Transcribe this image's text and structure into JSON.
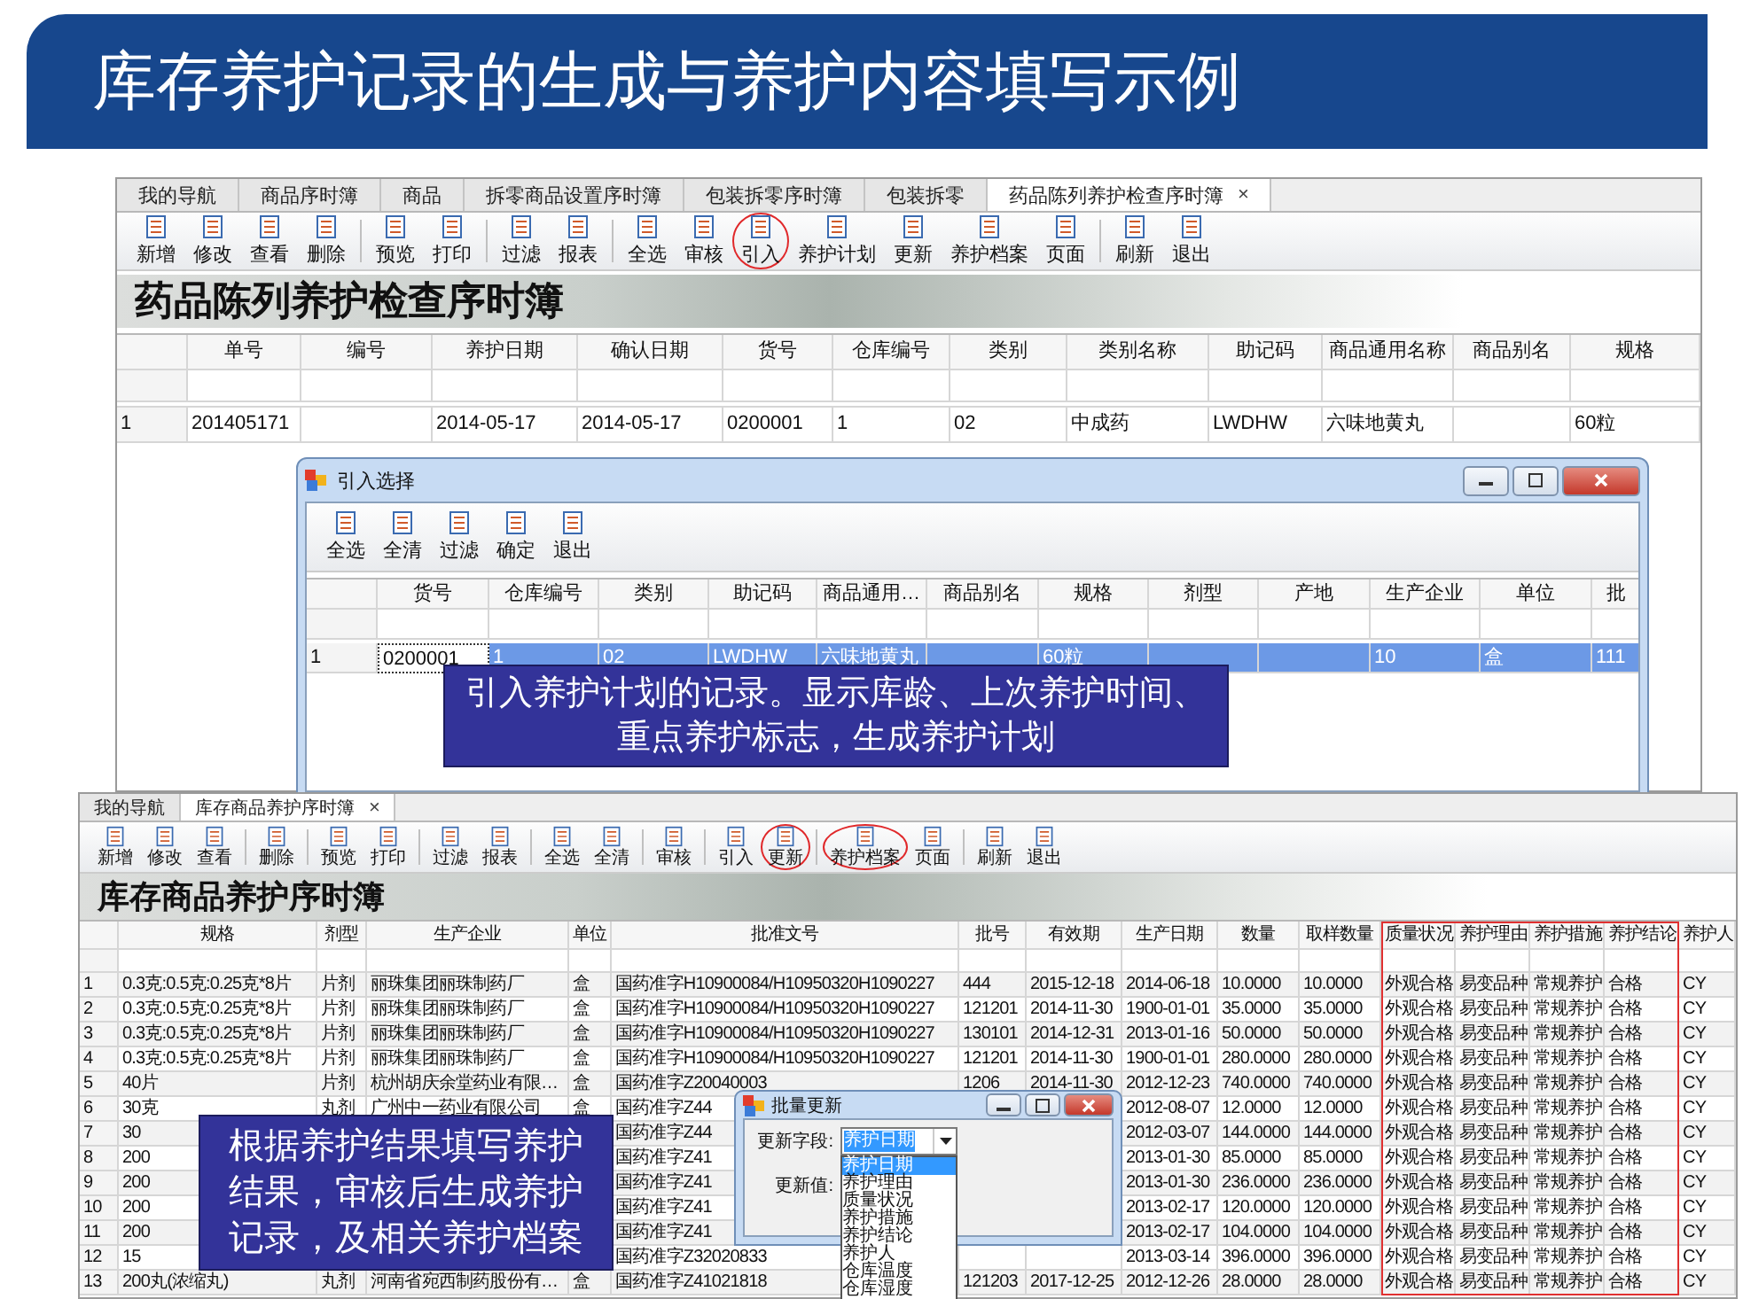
{
  "slide_title": "库存养护记录的生成与养护内容填写示例",
  "main_window": {
    "tabs": [
      {
        "label": "我的导航",
        "selected": false
      },
      {
        "label": "商品序时簿",
        "selected": false
      },
      {
        "label": "商品",
        "selected": false
      },
      {
        "label": "拆零商品设置序时簿",
        "selected": false
      },
      {
        "label": "包装拆零序时簿",
        "selected": false
      },
      {
        "label": "包装拆零",
        "selected": false
      },
      {
        "label": "药品陈列养护检查序时簿",
        "selected": true,
        "close": "×"
      }
    ],
    "toolbar": [
      {
        "label": "新增",
        "separator_before": false,
        "circled": false
      },
      {
        "label": "修改",
        "separator_before": false,
        "circled": false
      },
      {
        "label": "查看",
        "separator_before": false,
        "circled": false
      },
      {
        "label": "删除",
        "separator_before": false,
        "circled": false
      },
      {
        "label": "预览",
        "separator_before": true,
        "circled": false
      },
      {
        "label": "打印",
        "separator_before": false,
        "circled": false
      },
      {
        "label": "过滤",
        "separator_before": true,
        "circled": false
      },
      {
        "label": "报表",
        "separator_before": false,
        "circled": false
      },
      {
        "label": "全选",
        "separator_before": true,
        "circled": false
      },
      {
        "label": "审核",
        "separator_before": false,
        "circled": false
      },
      {
        "label": "引入",
        "separator_before": false,
        "circled": true
      },
      {
        "label": "养护计划",
        "separator_before": false,
        "circled": false
      },
      {
        "label": "更新",
        "separator_before": false,
        "circled": false
      },
      {
        "label": "养护档案",
        "separator_before": false,
        "circled": false
      },
      {
        "label": "页面",
        "separator_before": false,
        "circled": false
      },
      {
        "label": "刷新",
        "separator_before": true,
        "circled": false
      },
      {
        "label": "退出",
        "separator_before": false,
        "circled": false
      }
    ],
    "header": "药品陈列养护检查序时簿",
    "columns": [
      {
        "label": "单号"
      },
      {
        "label": "编号"
      },
      {
        "label": "养护日期"
      },
      {
        "label": "确认日期"
      },
      {
        "label": "货号"
      },
      {
        "label": "仓库编号"
      },
      {
        "label": "类别"
      },
      {
        "label": "类别名称"
      },
      {
        "label": "助记码"
      },
      {
        "label": "商品通用名称"
      },
      {
        "label": "商品别名"
      },
      {
        "label": "规格"
      }
    ],
    "rows": [
      {
        "number": "1",
        "cells": [
          "201405171",
          null,
          "2014-05-17",
          "2014-05-17",
          "0200001",
          "1",
          "02",
          "中成药",
          "LWDHW",
          "六味地黄丸",
          null,
          "60粒"
        ]
      }
    ]
  },
  "import_dialog": {
    "title": "引入选择",
    "toolbar": [
      {
        "label": "全选",
        "separator_before": false,
        "circled": false
      },
      {
        "label": "全清",
        "separator_before": false,
        "circled": false
      },
      {
        "label": "过滤",
        "separator_before": false,
        "circled": false
      },
      {
        "label": "确定",
        "separator_before": false,
        "circled": false
      },
      {
        "label": "退出",
        "separator_before": false,
        "circled": false
      }
    ],
    "columns": [
      {
        "label": "货号"
      },
      {
        "label": "仓库编号"
      },
      {
        "label": "类别"
      },
      {
        "label": "助记码"
      },
      {
        "label": "商品通用…"
      },
      {
        "label": "商品别名"
      },
      {
        "label": "规格"
      },
      {
        "label": "剂型"
      },
      {
        "label": "产地"
      },
      {
        "label": "生产企业"
      },
      {
        "label": "单位"
      },
      {
        "label": "批"
      }
    ],
    "rows": [
      {
        "number": "1",
        "selected": true,
        "cells": [
          {
            "text": "0200001",
            "focused": true
          },
          {
            "text": "1",
            "focused": false
          },
          {
            "text": "02",
            "focused": false
          },
          {
            "text": "LWDHW",
            "focused": false
          },
          {
            "text": "六味地黄丸",
            "focused": false
          },
          {
            "text": null,
            "focused": false
          },
          {
            "text": "60粒",
            "focused": false
          },
          {
            "text": null,
            "focused": false
          },
          {
            "text": null,
            "focused": false
          },
          {
            "text": "10",
            "focused": false
          },
          {
            "text": "盒",
            "focused": false
          },
          {
            "text": "111",
            "focused": false
          }
        ]
      }
    ]
  },
  "import_callout": "引入养护计划的记录。显示库龄、上次养护时间、重点养护标志，生成养护计划",
  "stock_window": {
    "tabs": [
      {
        "label": "我的导航",
        "selected": false
      },
      {
        "label": "库存商品养护序时簿",
        "selected": true,
        "close": "×"
      }
    ],
    "toolbar": [
      {
        "label": "新增",
        "separator_before": false,
        "circled": false
      },
      {
        "label": "修改",
        "separator_before": false,
        "circled": false
      },
      {
        "label": "查看",
        "separator_before": false,
        "circled": false
      },
      {
        "label": "删除",
        "separator_before": true,
        "circled": false
      },
      {
        "label": "预览",
        "separator_before": true,
        "circled": false
      },
      {
        "label": "打印",
        "separator_before": false,
        "circled": false
      },
      {
        "label": "过滤",
        "separator_before": true,
        "circled": false
      },
      {
        "label": "报表",
        "separator_before": false,
        "circled": false
      },
      {
        "label": "全选",
        "separator_before": true,
        "circled": false
      },
      {
        "label": "全清",
        "separator_before": false,
        "circled": false
      },
      {
        "label": "审核",
        "separator_before": true,
        "circled": false
      },
      {
        "label": "引入",
        "separator_before": true,
        "circled": false
      },
      {
        "label": "更新",
        "separator_before": false,
        "circled": true
      },
      {
        "label": "养护档案",
        "separator_before": true,
        "circled": true
      },
      {
        "label": "页面",
        "separator_before": false,
        "circled": false
      },
      {
        "label": "刷新",
        "separator_before": true,
        "circled": false
      },
      {
        "label": "退出",
        "separator_before": false,
        "circled": false
      }
    ],
    "header": "库存商品养护序时簿",
    "columns": [
      {
        "label": "规格",
        "highlighted": false
      },
      {
        "label": "剂型",
        "highlighted": false
      },
      {
        "label": "生产企业",
        "highlighted": false
      },
      {
        "label": "单位",
        "highlighted": false
      },
      {
        "label": "批准文号",
        "highlighted": false
      },
      {
        "label": "批号",
        "highlighted": false
      },
      {
        "label": "有效期",
        "highlighted": false
      },
      {
        "label": "生产日期",
        "highlighted": false
      },
      {
        "label": "数量",
        "highlighted": false
      },
      {
        "label": "取样数量",
        "highlighted": false
      },
      {
        "label": "质量状况",
        "highlighted": true
      },
      {
        "label": "养护理由",
        "highlighted": true
      },
      {
        "label": "养护措施",
        "highlighted": true
      },
      {
        "label": "养护结论",
        "highlighted": true
      },
      {
        "label": "养护人",
        "highlighted": false
      }
    ],
    "rows": [
      {
        "number": "1",
        "cells": [
          "0.3克:0.5克:0.25克*8片",
          "片剂",
          "丽珠集团丽珠制药厂",
          "盒",
          "国药准字H10900084/H10950320H1090227",
          "444",
          "2015-12-18",
          "2014-06-18",
          "10.0000",
          "10.0000",
          "外观合格",
          "易变品种",
          "常规养护",
          "合格",
          "CY"
        ]
      },
      {
        "number": "2",
        "cells": [
          "0.3克:0.5克:0.25克*8片",
          "片剂",
          "丽珠集团丽珠制药厂",
          "盒",
          "国药准字H10900084/H10950320H1090227",
          "121201",
          "2014-11-30",
          "1900-01-01",
          "35.0000",
          "35.0000",
          "外观合格",
          "易变品种",
          "常规养护",
          "合格",
          "CY"
        ]
      },
      {
        "number": "3",
        "cells": [
          "0.3克:0.5克:0.25克*8片",
          "片剂",
          "丽珠集团丽珠制药厂",
          "盒",
          "国药准字H10900084/H10950320H1090227",
          "130101",
          "2014-12-31",
          "2013-01-16",
          "50.0000",
          "50.0000",
          "外观合格",
          "易变品种",
          "常规养护",
          "合格",
          "CY"
        ]
      },
      {
        "number": "4",
        "cells": [
          "0.3克:0.5克:0.25克*8片",
          "片剂",
          "丽珠集团丽珠制药厂",
          "盒",
          "国药准字H10900084/H10950320H1090227",
          "121201",
          "2014-11-30",
          "1900-01-01",
          "280.0000",
          "280.0000",
          "外观合格",
          "易变品种",
          "常规养护",
          "合格",
          "CY"
        ]
      },
      {
        "number": "5",
        "cells": [
          "40片",
          "片剂",
          "杭州胡庆余堂药业有限…",
          "盒",
          "国药准字Z20040003",
          "1206",
          "2014-11-30",
          "2012-12-23",
          "740.0000",
          "740.0000",
          "外观合格",
          "易变品种",
          "常规养护",
          "合格",
          "CY"
        ]
      },
      {
        "number": "6",
        "cells": [
          "30克",
          "丸剂",
          "广州中一药业有限公司",
          "盒",
          "国药准字Z44",
          null,
          null,
          "2012-08-07",
          "12.0000",
          "12.0000",
          "外观合格",
          "易变品种",
          "常规养护",
          "合格",
          "CY"
        ]
      },
      {
        "number": "7",
        "cells": [
          "30",
          null,
          null,
          null,
          "国药准字Z44",
          null,
          null,
          "2012-03-07",
          "144.0000",
          "144.0000",
          "外观合格",
          "易变品种",
          "常规养护",
          "合格",
          "CY"
        ]
      },
      {
        "number": "8",
        "cells": [
          "200",
          null,
          null,
          null,
          "国药准字Z41",
          null,
          null,
          "2013-01-30",
          "85.0000",
          "85.0000",
          "外观合格",
          "易变品种",
          "常规养护",
          "合格",
          "CY"
        ]
      },
      {
        "number": "9",
        "cells": [
          "200",
          null,
          null,
          null,
          "国药准字Z41",
          null,
          null,
          "2013-01-30",
          "236.0000",
          "236.0000",
          "外观合格",
          "易变品种",
          "常规养护",
          "合格",
          "CY"
        ]
      },
      {
        "number": "10",
        "cells": [
          "200",
          null,
          null,
          null,
          "国药准字Z41",
          null,
          null,
          "2013-02-17",
          "120.0000",
          "120.0000",
          "外观合格",
          "易变品种",
          "常规养护",
          "合格",
          "CY"
        ]
      },
      {
        "number": "11",
        "cells": [
          "200",
          null,
          null,
          null,
          "国药准字Z41",
          null,
          null,
          "2013-02-17",
          "104.0000",
          "104.0000",
          "外观合格",
          "易变品种",
          "常规养护",
          "合格",
          "CY"
        ]
      },
      {
        "number": "12",
        "cells": [
          "15",
          null,
          null,
          null,
          "国药准字Z32020833",
          null,
          null,
          "2013-03-14",
          "396.0000",
          "396.0000",
          "外观合格",
          "易变品种",
          "常规养护",
          "合格",
          "CY"
        ]
      },
      {
        "number": "13",
        "cells": [
          "200丸(浓缩丸)",
          "丸剂",
          "河南省宛西制药股份有…",
          "盒",
          "国药准字Z41021818",
          "121203",
          "2017-12-25",
          "2012-12-26",
          "28.0000",
          "28.0000",
          "外观合格",
          "易变品种",
          "常规养护",
          "合格",
          "CY"
        ]
      }
    ]
  },
  "batch_dialog": {
    "title": "批量更新",
    "field_label": "更新字段:",
    "field_value": "养护日期",
    "value_label": "更新值:",
    "options": [
      {
        "label": "养护日期",
        "selected": true
      },
      {
        "label": "养护理由",
        "selected": false
      },
      {
        "label": "质量状况",
        "selected": false
      },
      {
        "label": "养护措施",
        "selected": false
      },
      {
        "label": "养护结论",
        "selected": false
      },
      {
        "label": "养护人",
        "selected": false
      },
      {
        "label": "仓库温度",
        "selected": false
      },
      {
        "label": "仓库湿度",
        "selected": false
      }
    ]
  },
  "result_callout": "根据养护结果填写养护结果，审核后生成养护记录，及相关养护档案"
}
